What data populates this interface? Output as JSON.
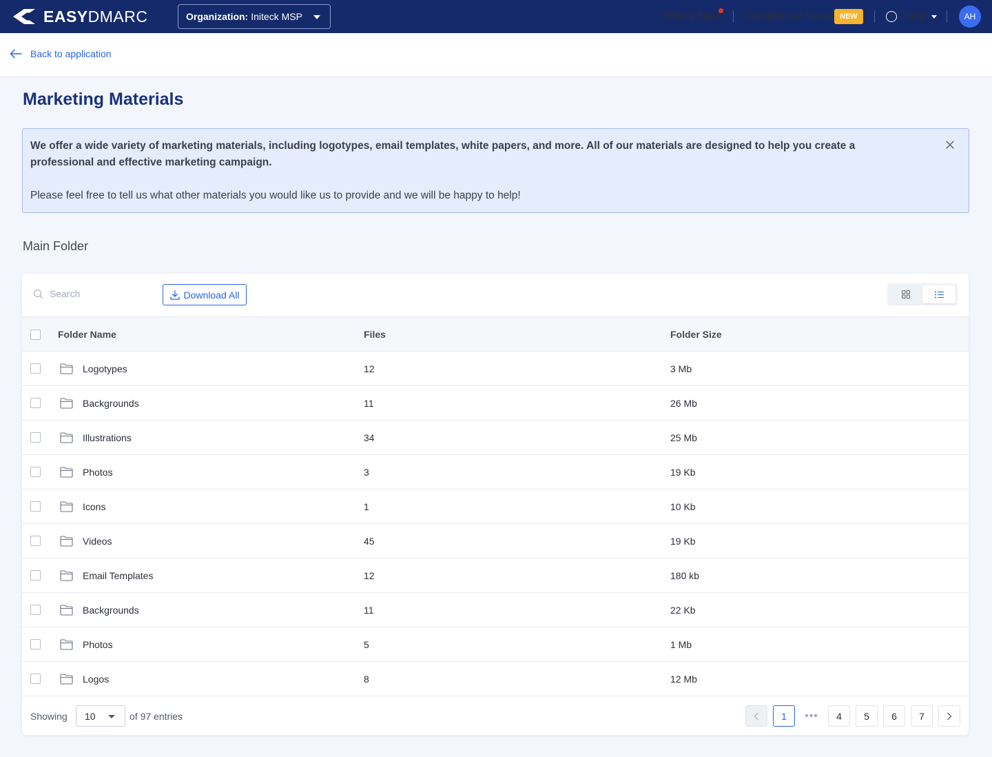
{
  "brand": {
    "name_bold": "EASY",
    "name_regular": "DMARC"
  },
  "header": {
    "org_label": "Organization:",
    "org_value": "Initeck MSP",
    "whats_new": "What's New?",
    "compliance": "Compliance Service",
    "new_badge": "NEW",
    "help": "Help",
    "avatar_initials": "AH"
  },
  "back_link": "Back to application",
  "page_title": "Marketing Materials",
  "info": {
    "line1": "We offer a wide variety of marketing materials, including logotypes, email templates, white papers, and more. All of our materials are designed to help you create a professional and effective marketing campaign.",
    "line2": "Please feel free to tell us what other materials you would like us to provide and we will be happy to help!"
  },
  "section_title": "Main Folder",
  "toolbar": {
    "search_placeholder": "Search",
    "download_all": "Download All"
  },
  "table": {
    "columns": [
      "Folder Name",
      "Files",
      "Folder Size"
    ],
    "rows": [
      {
        "name": "Logotypes",
        "files": "12",
        "size": "3 Mb"
      },
      {
        "name": "Backgrounds",
        "files": "11",
        "size": "26 Mb"
      },
      {
        "name": "Illustrations",
        "files": "34",
        "size": "25 Mb"
      },
      {
        "name": "Photos",
        "files": "3",
        "size": "19 Kb"
      },
      {
        "name": "Icons",
        "files": "1",
        "size": "10 Kb"
      },
      {
        "name": "Videos",
        "files": "45",
        "size": "19 Kb"
      },
      {
        "name": "Email Templates",
        "files": "12",
        "size": "180 kb"
      },
      {
        "name": "Backgrounds",
        "files": "11",
        "size": "22 Kb"
      },
      {
        "name": "Photos",
        "files": "5",
        "size": "1 Mb"
      },
      {
        "name": "Logos",
        "files": "8",
        "size": "12 Mb"
      }
    ]
  },
  "footer": {
    "showing": "Showing",
    "page_size": "10",
    "entries": "of 97 entries",
    "pages": [
      "1",
      "4",
      "5",
      "6",
      "7"
    ],
    "current_page": "1",
    "ellipsis": "•••"
  },
  "colors": {
    "nav_bg": "#152a6b",
    "accent": "#2b63e6",
    "new_badge": "#f7b32b",
    "title": "#1b3278"
  }
}
